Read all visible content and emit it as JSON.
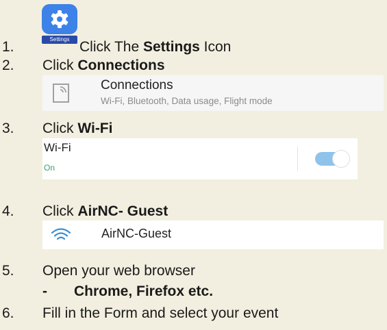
{
  "settings_icon": {
    "icon": "gear-icon",
    "caption": "Settings",
    "tile_color": "#3d82e8"
  },
  "steps": [
    {
      "number": "1.",
      "pre": "Click The ",
      "bold": "Settings",
      "post": " Icon"
    },
    {
      "number": "2.",
      "pre": "Click ",
      "bold": "Connections",
      "post": ""
    },
    {
      "number": "3.",
      "pre": "Click ",
      "bold": "Wi-Fi",
      "post": ""
    },
    {
      "number": "4.",
      "pre": "Click ",
      "bold": "AirNC- Guest",
      "post": ""
    },
    {
      "number": "5.",
      "pre": "Open your web browser",
      "bold": "",
      "post": ""
    },
    {
      "number": "6.",
      "pre": "Fill in the Form and select your event",
      "bold": "",
      "post": ""
    }
  ],
  "connections_card": {
    "icon": "connections-icon",
    "title": "Connections",
    "subtitle": "Wi-Fi, Bluetooth, Data usage, Flight mode"
  },
  "wifi_setting": {
    "title": "Wi-Fi",
    "status": "On",
    "toggle_on": true,
    "status_color": "#3a9d6c",
    "toggle_color": "#8fc3ea"
  },
  "network": {
    "icon": "wifi-icon",
    "name": "AirNC-Guest"
  },
  "browser_note": {
    "dash": "-",
    "text": "Chrome, Firefox etc."
  }
}
